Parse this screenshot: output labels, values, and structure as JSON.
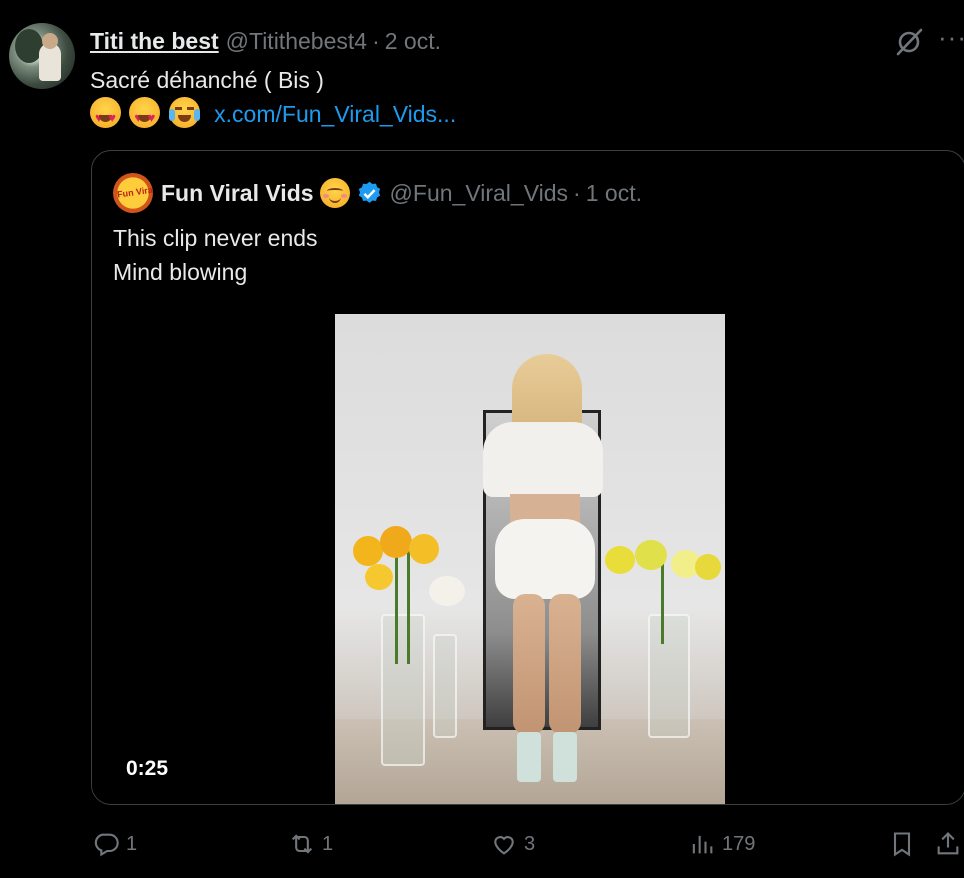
{
  "tweet": {
    "author_name": "Titi the best",
    "author_handle": "@Titithebest4",
    "separator": "·",
    "date": "2 oct.",
    "text": "Sacré déhanché  ( Bis )",
    "link": "x.com/Fun_Viral_Vids...",
    "emojis": [
      "heart-eyes-emoji",
      "heart-eyes-emoji",
      "tears-of-joy-emoji"
    ],
    "more_label": "···"
  },
  "quote": {
    "author_name": "Fun Viral Vids",
    "avatar_text": "Fun Viral",
    "author_handle": "@Fun_Viral_Vids",
    "separator": "·",
    "date": "1 oct.",
    "line1": "This clip never ends",
    "line2": "Mind blowing",
    "video_duration": "0:25"
  },
  "actions": {
    "replies": "1",
    "reposts": "1",
    "likes": "3",
    "views": "179"
  },
  "colors": {
    "background": "#000000",
    "text": "#e7e9ea",
    "muted": "#71767b",
    "link": "#1d9bf0",
    "border": "#3a3f44"
  }
}
